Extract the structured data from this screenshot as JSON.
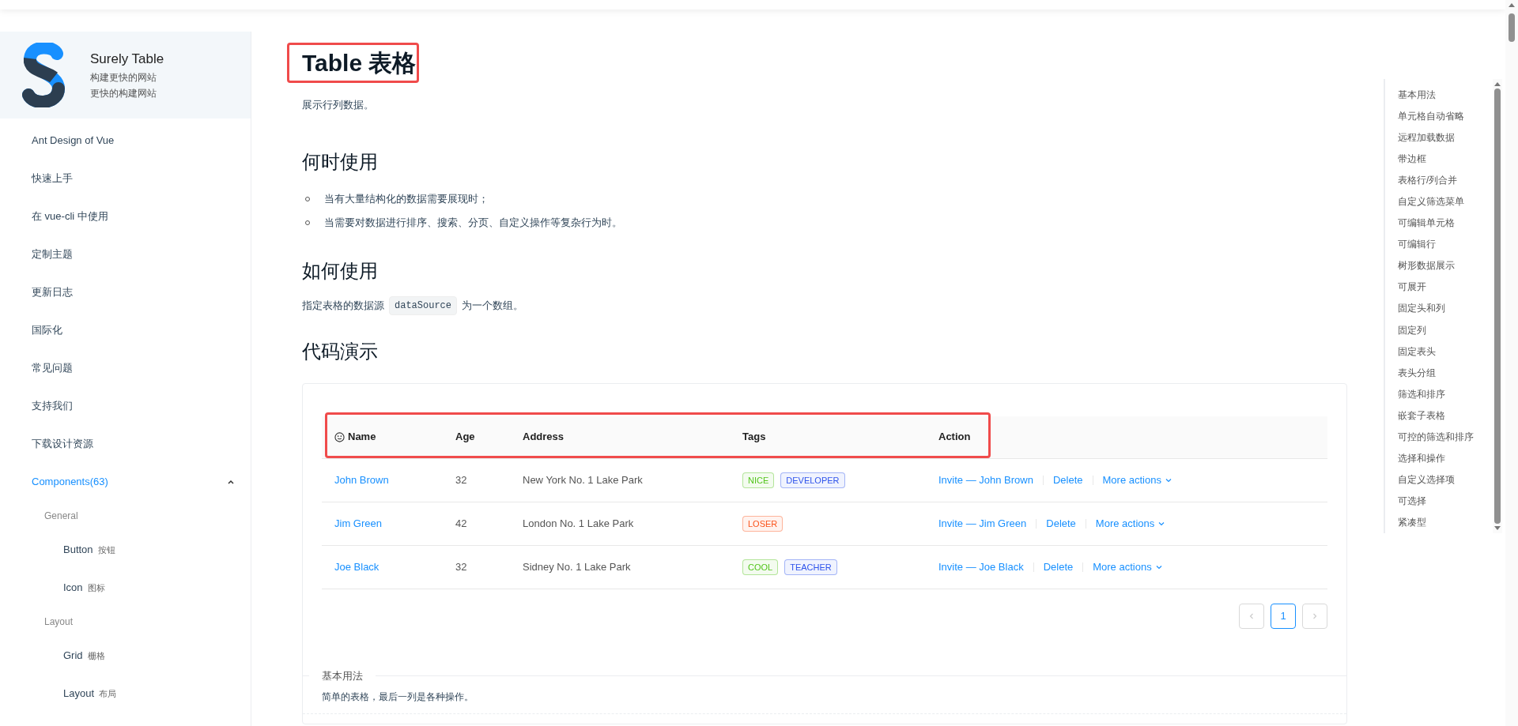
{
  "brand": {
    "title": "Surely Table",
    "lines": [
      "构建更快的网站",
      "更快的构建网站"
    ]
  },
  "sidebar": {
    "items": [
      {
        "kind": "link",
        "label": "Ant Design of Vue"
      },
      {
        "kind": "link",
        "label": "快速上手"
      },
      {
        "kind": "link",
        "label": "在 vue-cli 中使用"
      },
      {
        "kind": "link",
        "label": "定制主题"
      },
      {
        "kind": "link",
        "label": "更新日志"
      },
      {
        "kind": "link",
        "label": "国际化"
      },
      {
        "kind": "link",
        "label": "常见问题"
      },
      {
        "kind": "link",
        "label": "支持我们"
      },
      {
        "kind": "link",
        "label": "下载设计资源"
      },
      {
        "kind": "submenu",
        "label": "Components(63)",
        "expanded": true,
        "groups": [
          {
            "title": "General",
            "items": [
              {
                "label": "Button",
                "sub": "按钮"
              },
              {
                "label": "Icon",
                "sub": "图标"
              }
            ]
          },
          {
            "title": "Layout",
            "items": [
              {
                "label": "Grid",
                "sub": "栅格"
              },
              {
                "label": "Layout",
                "sub": "布局"
              }
            ]
          }
        ]
      }
    ]
  },
  "page": {
    "title": "Table 表格",
    "intro": "展示行列数据。",
    "sections": [
      {
        "heading": "何时使用",
        "bullets": [
          "当有大量结构化的数据需要展现时；",
          "当需要对数据进行排序、搜索、分页、自定义操作等复杂行为时。"
        ]
      },
      {
        "heading": "如何使用",
        "text_before": "指定表格的数据源",
        "code": "dataSource",
        "text_after": "为一个数组。"
      },
      {
        "heading": "代码演示"
      }
    ]
  },
  "demo": {
    "table": {
      "columns": [
        "Name",
        "Age",
        "Address",
        "Tags",
        "Action"
      ],
      "rows": [
        {
          "name": "John Brown",
          "age": "32",
          "address": "New York No. 1 Lake Park",
          "tags": [
            {
              "label": "NICE",
              "color": "#52c41a"
            },
            {
              "label": "DEVELOPER",
              "color": "#2f54eb"
            }
          ],
          "actions": [
            "Invite — John Brown",
            "Delete",
            "More actions"
          ]
        },
        {
          "name": "Jim Green",
          "age": "42",
          "address": "London No. 1 Lake Park",
          "tags": [
            {
              "label": "LOSER",
              "color": "#fa541c"
            }
          ],
          "actions": [
            "Invite — Jim Green",
            "Delete",
            "More actions"
          ]
        },
        {
          "name": "Joe Black",
          "age": "32",
          "address": "Sidney No. 1 Lake Park",
          "tags": [
            {
              "label": "COOL",
              "color": "#52c41a"
            },
            {
              "label": "TEACHER",
              "color": "#2f54eb"
            }
          ],
          "actions": [
            "Invite — Joe Black",
            "Delete",
            "More actions"
          ]
        }
      ]
    },
    "pagination": {
      "prev_disabled": true,
      "next_disabled": true,
      "pages": [
        {
          "label": "1",
          "selected": true
        }
      ]
    },
    "meta_title": "基本用法",
    "meta_text": "简单的表格，最后一列是各种操作。"
  },
  "toc": [
    "基本用法",
    "单元格自动省略",
    "远程加载数据",
    "带边框",
    "表格行/列合并",
    "自定义筛选菜单",
    "可编辑单元格",
    "可编辑行",
    "树形数据展示",
    "可展开",
    "固定头和列",
    "固定列",
    "固定表头",
    "表头分组",
    "筛选和排序",
    "嵌套子表格",
    "可控的筛选和排序",
    "选择和操作",
    "自定义选择项",
    "可选择",
    "紧凑型"
  ]
}
